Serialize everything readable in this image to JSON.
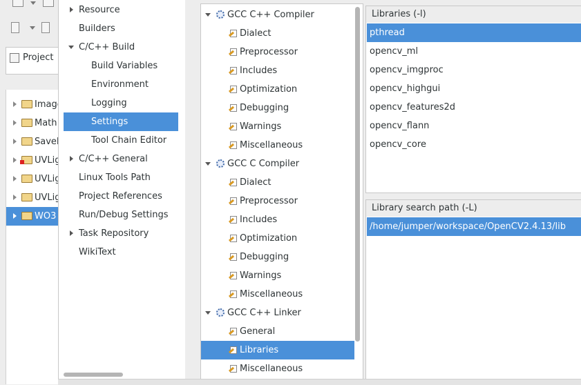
{
  "project_explorer": {
    "tab_label": "Project",
    "items": [
      {
        "label": "Image",
        "icon": "folder-icon",
        "error": false,
        "selected": false
      },
      {
        "label": "Math",
        "icon": "folder-icon",
        "error": false,
        "selected": false
      },
      {
        "label": "Savel",
        "icon": "folder-icon",
        "error": false,
        "selected": false
      },
      {
        "label": "UVLig",
        "icon": "folder-error-icon",
        "error": true,
        "selected": false
      },
      {
        "label": "UVLig",
        "icon": "folder-icon",
        "error": false,
        "selected": false
      },
      {
        "label": "UVLig",
        "icon": "folder-icon",
        "error": false,
        "selected": false
      },
      {
        "label": "WO3",
        "icon": "folder-icon",
        "error": false,
        "selected": true
      }
    ]
  },
  "categories": [
    {
      "label": "Resource",
      "expander": "collapsed",
      "indent": 0,
      "selected": false
    },
    {
      "label": "Builders",
      "expander": "none",
      "indent": 0,
      "selected": false
    },
    {
      "label": "C/C++ Build",
      "expander": "expanded",
      "indent": 0,
      "selected": false
    },
    {
      "label": "Build Variables",
      "expander": "none",
      "indent": 1,
      "selected": false
    },
    {
      "label": "Environment",
      "expander": "none",
      "indent": 1,
      "selected": false
    },
    {
      "label": "Logging",
      "expander": "none",
      "indent": 1,
      "selected": false
    },
    {
      "label": "Settings",
      "expander": "none",
      "indent": 1,
      "selected": true
    },
    {
      "label": "Tool Chain Editor",
      "expander": "none",
      "indent": 1,
      "selected": false
    },
    {
      "label": "C/C++ General",
      "expander": "collapsed",
      "indent": 0,
      "selected": false
    },
    {
      "label": "Linux Tools Path",
      "expander": "none",
      "indent": 0,
      "selected": false
    },
    {
      "label": "Project References",
      "expander": "none",
      "indent": 0,
      "selected": false
    },
    {
      "label": "Run/Debug Settings",
      "expander": "none",
      "indent": 0,
      "selected": false
    },
    {
      "label": "Task Repository",
      "expander": "collapsed",
      "indent": 0,
      "selected": false
    },
    {
      "label": "WikiText",
      "expander": "none",
      "indent": 0,
      "selected": false
    }
  ],
  "tool_settings": [
    {
      "label": "GCC C++ Compiler",
      "type": "tool",
      "selected": false
    },
    {
      "label": "Dialect",
      "type": "option",
      "selected": false
    },
    {
      "label": "Preprocessor",
      "type": "option",
      "selected": false
    },
    {
      "label": "Includes",
      "type": "option",
      "selected": false
    },
    {
      "label": "Optimization",
      "type": "option",
      "selected": false
    },
    {
      "label": "Debugging",
      "type": "option",
      "selected": false
    },
    {
      "label": "Warnings",
      "type": "option",
      "selected": false
    },
    {
      "label": "Miscellaneous",
      "type": "option",
      "selected": false
    },
    {
      "label": "GCC C Compiler",
      "type": "tool",
      "selected": false
    },
    {
      "label": "Dialect",
      "type": "option",
      "selected": false
    },
    {
      "label": "Preprocessor",
      "type": "option",
      "selected": false
    },
    {
      "label": "Includes",
      "type": "option",
      "selected": false
    },
    {
      "label": "Optimization",
      "type": "option",
      "selected": false
    },
    {
      "label": "Debugging",
      "type": "option",
      "selected": false
    },
    {
      "label": "Warnings",
      "type": "option",
      "selected": false
    },
    {
      "label": "Miscellaneous",
      "type": "option",
      "selected": false
    },
    {
      "label": "GCC C++ Linker",
      "type": "tool",
      "selected": false
    },
    {
      "label": "General",
      "type": "option",
      "selected": false
    },
    {
      "label": "Libraries",
      "type": "option",
      "selected": true
    },
    {
      "label": "Miscellaneous",
      "type": "option",
      "selected": false
    }
  ],
  "libraries": {
    "header": "Libraries (-l)",
    "items": [
      "pthread",
      "opencv_ml",
      "opencv_imgproc",
      "opencv_highgui",
      "opencv_features2d",
      "opencv_flann",
      "opencv_core"
    ],
    "selected_index": 0
  },
  "library_search_path": {
    "header": "Library search path (-L)",
    "items": [
      "/home/jumper/workspace/OpenCV2.4.13/lib"
    ],
    "selected_index": 0
  },
  "colors": {
    "selection": "#4a90d9",
    "panel_bg": "#ffffff",
    "window_bg": "#ededed"
  }
}
